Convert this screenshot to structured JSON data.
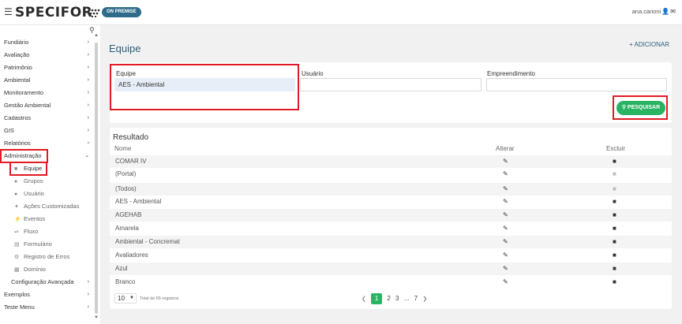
{
  "header": {
    "brand": "SPECIFOR",
    "badge": "ON PREMISE",
    "user": "ana.carioni"
  },
  "sidebar": {
    "items": [
      {
        "label": "Fundiário"
      },
      {
        "label": "Avaliação"
      },
      {
        "label": "Patrimônio"
      },
      {
        "label": "Ambiental"
      },
      {
        "label": "Monitoramento"
      },
      {
        "label": "Gestão Ambiental"
      },
      {
        "label": "Cadastros"
      },
      {
        "label": "GIS"
      },
      {
        "label": "Relatórios"
      },
      {
        "label": "Administração"
      }
    ],
    "submenu": [
      {
        "label": "Equipe"
      },
      {
        "label": "Grupos"
      },
      {
        "label": "Usuário"
      },
      {
        "label": "Ações Customizadas"
      },
      {
        "label": "Eventos"
      },
      {
        "label": "Fluxo"
      },
      {
        "label": "Formulário"
      },
      {
        "label": "Registro de Erros"
      },
      {
        "label": "Domínio"
      }
    ],
    "config": "Configuração Avançada",
    "bottom_items": [
      {
        "label": "Exemplos"
      },
      {
        "label": "Teste Menu"
      }
    ]
  },
  "page": {
    "title": "Equipe",
    "add": "+ ADICIONAR"
  },
  "filters": {
    "equipe_label": "Equipe",
    "equipe_value": "AES - Ambiental",
    "usuario_label": "Usuário",
    "usuario_value": "",
    "empreendimento_label": "Empreendimento",
    "empreendimento_value": "",
    "search_button": "PESQUISAR"
  },
  "results": {
    "title": "Resultado",
    "col_name": "Nome",
    "col_edit": "Alterar",
    "col_delete": "Excluir",
    "rows": [
      {
        "name": "COMAR IV"
      },
      {
        "name": "(Portal)"
      },
      {
        "name": "(Todos)"
      },
      {
        "name": "AES - Ambiental"
      },
      {
        "name": "AGEHAB"
      },
      {
        "name": "Amarela"
      },
      {
        "name": "Ambiental - Concremat"
      },
      {
        "name": "Avaliadores"
      },
      {
        "name": "Azul"
      },
      {
        "name": "Branco"
      }
    ]
  },
  "pagination": {
    "page_size": "10",
    "total": "Total de 65 registros",
    "pages": [
      "1",
      "2",
      "3",
      "...",
      "7"
    ]
  },
  "colors": {
    "accent": "#2d5f7a",
    "success": "#28b463",
    "highlight": "#e01b24"
  }
}
